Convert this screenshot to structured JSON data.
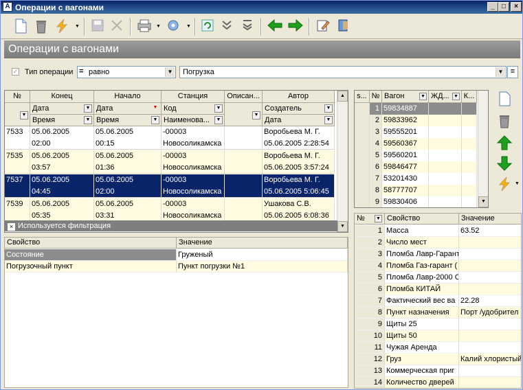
{
  "window": {
    "title": "Операции с вагонами",
    "header": "Операции с вагонами"
  },
  "filter": {
    "label": "Тип операции",
    "operator": "равно",
    "value": "Погрузка"
  },
  "ops": {
    "columns": [
      "№",
      "Конец",
      "Начало",
      "Станция",
      "Описан...",
      "Автор"
    ],
    "sub1": [
      "Дата",
      "Дата",
      "Код",
      "Создатель"
    ],
    "sub2": [
      "Время",
      "Время",
      "Наименова...",
      "Дата"
    ],
    "rows": [
      {
        "n": "7533",
        "end_d": "05.06.2005",
        "end_t": "02:00",
        "start_d": "05.06.2005",
        "start_t": "00:15",
        "code": "-00003",
        "station": "Новосоликамска",
        "author": "Воробьева М. Г.",
        "created": "05.06.2005 2:28:54"
      },
      {
        "n": "7535",
        "end_d": "05.06.2005",
        "end_t": "03:57",
        "start_d": "05.06.2005",
        "start_t": "01:36",
        "code": "-00003",
        "station": "Новосоликамска",
        "author": "Воробьева М. Г.",
        "created": "05.06.2005 3:57:24"
      },
      {
        "n": "7537",
        "end_d": "05.06.2005",
        "end_t": "04:45",
        "start_d": "05.06.2005",
        "start_t": "02:00",
        "code": "-00003",
        "station": "Новосоликамска",
        "author": "Воробьева М. Г.",
        "created": "05.06.2005 5:06:45"
      },
      {
        "n": "7539",
        "end_d": "05.06.2005",
        "end_t": "05:35",
        "start_d": "05.06.2005",
        "start_t": "03:31",
        "code": "-00003",
        "station": "Новосоликамска",
        "author": "Ушакова С.В.",
        "created": "05.06.2005 6:08:36"
      }
    ],
    "filter_status": "Используется фильтрация"
  },
  "props": {
    "columns": [
      "Свойство",
      "Значение"
    ],
    "rows": [
      {
        "name": "Состояние",
        "value": "Груженый"
      },
      {
        "name": "Погрузочный пункт",
        "value": "Пункт погрузки №1"
      }
    ]
  },
  "wagons": {
    "columns": [
      "s...",
      "№",
      "Вагон",
      "ЖД...",
      "К..."
    ],
    "rows": [
      {
        "n": "1",
        "wagon": "59834887"
      },
      {
        "n": "2",
        "wagon": "59833962"
      },
      {
        "n": "3",
        "wagon": "59555201"
      },
      {
        "n": "4",
        "wagon": "59560367"
      },
      {
        "n": "5",
        "wagon": "59560201"
      },
      {
        "n": "6",
        "wagon": "59846477"
      },
      {
        "n": "7",
        "wagon": "53201430"
      },
      {
        "n": "8",
        "wagon": "58777707"
      },
      {
        "n": "9",
        "wagon": "59830406"
      }
    ]
  },
  "wprops": {
    "columns": [
      "№",
      "Свойство",
      "Значение"
    ],
    "rows": [
      {
        "n": "1",
        "name": "Масса",
        "value": "63.52"
      },
      {
        "n": "2",
        "name": "Число мест",
        "value": ""
      },
      {
        "n": "3",
        "name": "Пломба Лавр-Гарант",
        "value": ""
      },
      {
        "n": "4",
        "name": "Пломба Газ-гарант (",
        "value": ""
      },
      {
        "n": "5",
        "name": "Пломба Лавр-2000 С",
        "value": ""
      },
      {
        "n": "6",
        "name": "Пломба КИТАЙ",
        "value": ""
      },
      {
        "n": "7",
        "name": "Фактический вес ва",
        "value": "22.28"
      },
      {
        "n": "8",
        "name": "Пункт назначения",
        "value": "Порт  /удобрител"
      },
      {
        "n": "9",
        "name": "Щиты 25",
        "value": ""
      },
      {
        "n": "10",
        "name": "Щиты 50",
        "value": ""
      },
      {
        "n": "11",
        "name": "Чужая Аренда",
        "value": ""
      },
      {
        "n": "12",
        "name": "Груз",
        "value": "Калий хлористый"
      },
      {
        "n": "13",
        "name": "Коммерческая приг",
        "value": ""
      },
      {
        "n": "14",
        "name": "Количество дверей",
        "value": ""
      }
    ]
  }
}
